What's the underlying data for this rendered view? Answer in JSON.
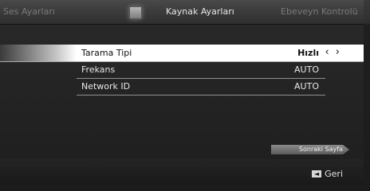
{
  "tabs": {
    "left": "Ses Ayarları",
    "center": "Kaynak Ayarları",
    "right": "Ebeveyn Kontrolü"
  },
  "settings": [
    {
      "label": "Tarama Tipi",
      "value": "Hızlı",
      "selected": true
    },
    {
      "label": "Frekans",
      "value": "AUTO",
      "selected": false
    },
    {
      "label": "Network ID",
      "value": "AUTO",
      "selected": false
    }
  ],
  "next_page": "Sonraki Sayfa",
  "back": "Geri",
  "icons": {
    "tab_icon": "source-icon",
    "arrows": "left-right-arrows-icon",
    "back_icon": "back-arrow-icon"
  }
}
